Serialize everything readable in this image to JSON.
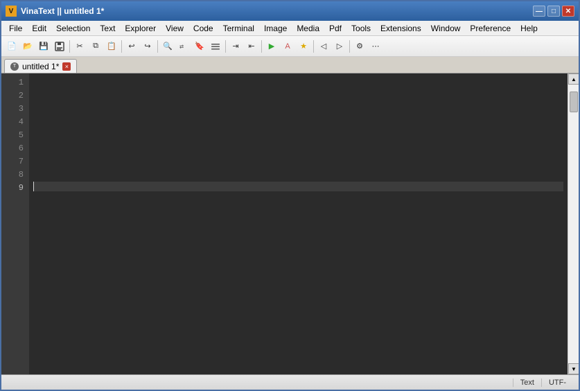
{
  "window": {
    "title": "VinaText || untitled 1*",
    "icon_label": "V"
  },
  "title_bar": {
    "minimize_label": "—",
    "maximize_label": "□",
    "close_label": "✕"
  },
  "menu": {
    "items": [
      "File",
      "Edit",
      "Selection",
      "Text",
      "Explorer",
      "View",
      "Code",
      "Terminal",
      "Image",
      "Media",
      "Pdf",
      "Tools",
      "Extensions",
      "Window",
      "Preference",
      "Help"
    ]
  },
  "toolbar": {
    "buttons": [
      {
        "name": "new-file",
        "icon": "📄"
      },
      {
        "name": "open-file",
        "icon": "📂"
      },
      {
        "name": "save-file",
        "icon": "💾"
      },
      {
        "name": "save-all",
        "icon": "💾"
      },
      {
        "name": "cut",
        "icon": "✂"
      },
      {
        "name": "copy",
        "icon": "⧉"
      },
      {
        "name": "paste",
        "icon": "📋"
      },
      {
        "name": "undo",
        "icon": "↩"
      },
      {
        "name": "redo",
        "icon": "↪"
      },
      {
        "name": "find",
        "icon": "🔍"
      },
      {
        "name": "replace",
        "icon": "🔄"
      },
      {
        "name": "bookmark",
        "icon": "🔖"
      },
      {
        "name": "indent",
        "icon": "⇥"
      },
      {
        "name": "outdent",
        "icon": "⇤"
      },
      {
        "name": "run",
        "icon": "▶"
      },
      {
        "name": "stop",
        "icon": "⏹"
      },
      {
        "name": "spell",
        "icon": "A"
      },
      {
        "name": "star",
        "icon": "★"
      },
      {
        "name": "prev-tab",
        "icon": "◀"
      },
      {
        "name": "next-tab",
        "icon": "▶"
      },
      {
        "name": "settings",
        "icon": "⚙"
      },
      {
        "name": "more",
        "icon": "⋯"
      }
    ]
  },
  "tab": {
    "name": "untitled 1*",
    "close_label": "×"
  },
  "editor": {
    "line_numbers": [
      1,
      2,
      3,
      4,
      5,
      6,
      7,
      8,
      9
    ],
    "current_line": 9,
    "content_lines": [
      "",
      "",
      "",
      "",
      "",
      "",
      "",
      "",
      ""
    ]
  },
  "status_bar": {
    "text_mode": "Text",
    "encoding": "UTF-",
    "status_left": ""
  }
}
